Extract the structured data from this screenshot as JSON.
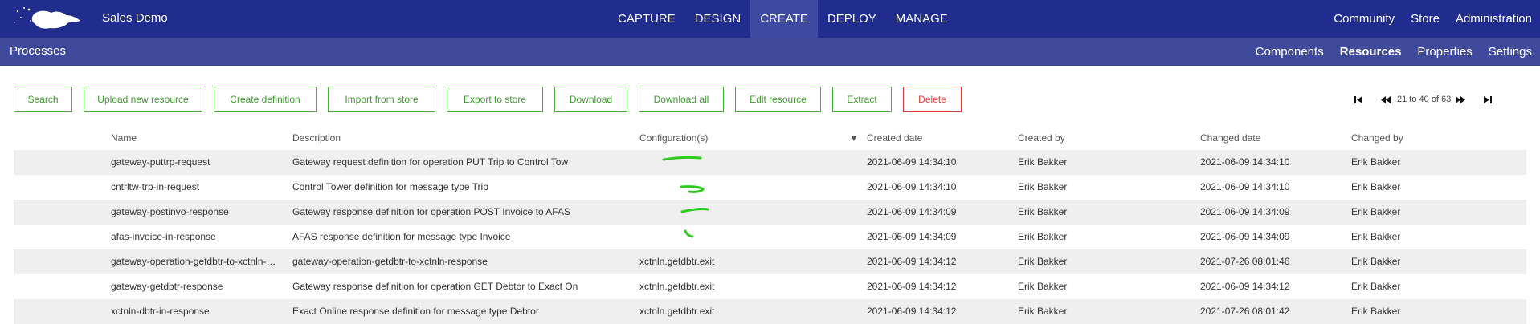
{
  "app": {
    "name": "Sales Demo"
  },
  "main_nav": [
    {
      "label": "CAPTURE",
      "active": false
    },
    {
      "label": "DESIGN",
      "active": false
    },
    {
      "label": "CREATE",
      "active": true
    },
    {
      "label": "DEPLOY",
      "active": false
    },
    {
      "label": "MANAGE",
      "active": false
    }
  ],
  "right_nav": [
    {
      "label": "Community"
    },
    {
      "label": "Store"
    },
    {
      "label": "Administration"
    }
  ],
  "sub_bar": {
    "section_title": "Processes",
    "items": [
      {
        "label": "Components",
        "active": false
      },
      {
        "label": "Resources",
        "active": true
      },
      {
        "label": "Properties",
        "active": false
      },
      {
        "label": "Settings",
        "active": false
      }
    ]
  },
  "toolbar": {
    "search": "Search",
    "upload": "Upload new resource",
    "create_definition": "Create definition",
    "import": "Import from store",
    "export": "Export to store",
    "download": "Download",
    "download_all": "Download all",
    "edit": "Edit resource",
    "extract": "Extract",
    "delete": "Delete"
  },
  "pager": {
    "text": "21 to 40 of 63"
  },
  "table": {
    "headers": {
      "name": "Name",
      "description": "Description",
      "configurations": "Configuration(s)",
      "created_date": "Created date",
      "created_by": "Created by",
      "changed_date": "Changed date",
      "changed_by": "Changed by"
    },
    "rows": [
      {
        "icon": "definition-icon",
        "name": "gateway-puttrp-request",
        "description": "Gateway request definition for operation PUT Trip to Control Tow",
        "configurations": "",
        "created_date": "2021-06-09 14:34:10",
        "created_by": "Erik Bakker",
        "changed_date": "2021-06-09 14:34:10",
        "changed_by": "Erik Bakker"
      },
      {
        "icon": "definition-icon",
        "name": "cntrltw-trp-in-request",
        "description": "Control Tower definition for message type Trip",
        "configurations": "",
        "created_date": "2021-06-09 14:34:10",
        "created_by": "Erik Bakker",
        "changed_date": "2021-06-09 14:34:10",
        "changed_by": "Erik Bakker"
      },
      {
        "icon": "definition-icon",
        "name": "gateway-postinvo-response",
        "description": "Gateway response definition for operation POST Invoice to AFAS",
        "configurations": "",
        "created_date": "2021-06-09 14:34:09",
        "created_by": "Erik Bakker",
        "changed_date": "2021-06-09 14:34:09",
        "changed_by": "Erik Bakker"
      },
      {
        "icon": "definition-icon",
        "name": "afas-invoice-in-response",
        "description": "AFAS response definition for message type Invoice",
        "configurations": "",
        "created_date": "2021-06-09 14:34:09",
        "created_by": "Erik Bakker",
        "changed_date": "2021-06-09 14:34:09",
        "changed_by": "Erik Bakker"
      },
      {
        "icon": "mapping-icon",
        "name": "gateway-operation-getdbtr-to-xctnln-…",
        "description": "gateway-operation-getdbtr-to-xctnln-response",
        "configurations": "xctnln.getdbtr.exit",
        "created_date": "2021-06-09 14:34:12",
        "created_by": "Erik Bakker",
        "changed_date": "2021-07-26 08:01:46",
        "changed_by": "Erik Bakker"
      },
      {
        "icon": "definition-icon",
        "name": "gateway-getdbtr-response",
        "description": "Gateway response definition for operation GET Debtor to Exact On",
        "configurations": "xctnln.getdbtr.exit",
        "created_date": "2021-06-09 14:34:12",
        "created_by": "Erik Bakker",
        "changed_date": "2021-06-09 14:34:12",
        "changed_by": "Erik Bakker"
      },
      {
        "icon": "definition-icon",
        "name": "xctnln-dbtr-in-response",
        "description": "Exact Online response definition for message type Debtor",
        "configurations": "xctnln.getdbtr.exit",
        "created_date": "2021-06-09 14:34:12",
        "created_by": "Erik Bakker",
        "changed_date": "2021-07-26 08:01:42",
        "changed_by": "Erik Bakker"
      }
    ]
  },
  "colors": {
    "topbar": "#202c8e",
    "subbar": "#404a9c",
    "accent_green": "#4caf3c",
    "danger_red": "#e53935",
    "annotation_green": "#2ecc1f"
  }
}
